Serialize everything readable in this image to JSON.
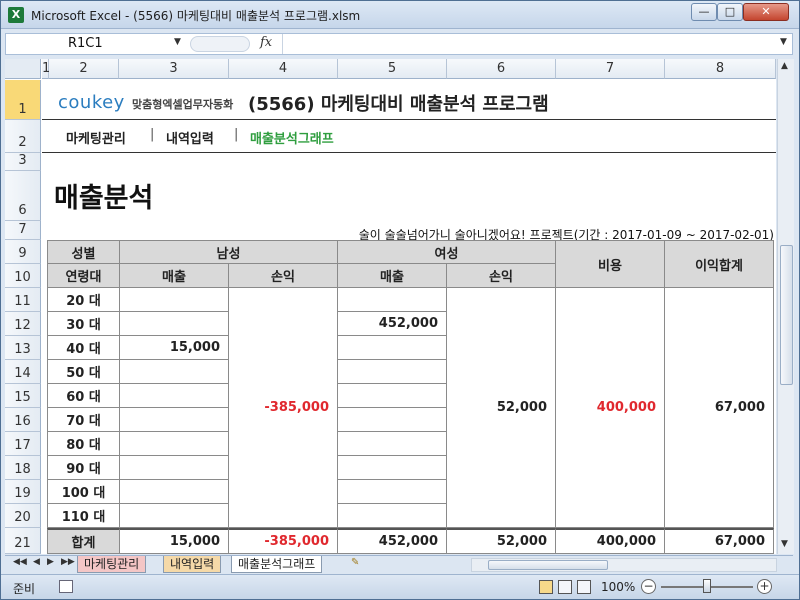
{
  "window": {
    "title": "Microsoft Excel - (5566) 마케팅대비 매출분석 프로그램.xlsm",
    "app_icon": "X"
  },
  "formula_bar": {
    "name_box": "R1C1",
    "fx": "fx",
    "value": ""
  },
  "columns": [
    "1",
    "2",
    "3",
    "4",
    "5",
    "6",
    "7",
    "8"
  ],
  "rows": [
    "1",
    "2",
    "3",
    "6",
    "7",
    "9",
    "10",
    "11",
    "12",
    "13",
    "14",
    "15",
    "16",
    "17",
    "18",
    "19",
    "20",
    "21"
  ],
  "sheet": {
    "brand": "coukey",
    "brand_sub": "맞춤형엑셀업무자동화",
    "doc_title": "(5566) 마케팅대비 매출분석 프로그램",
    "nav": [
      "마케팅관리",
      "내역입력",
      "매출분석그래프"
    ],
    "nav_sep": "|",
    "nav_active_color": "#2f9e3f",
    "heading": "매출분석",
    "period_note": "술이 술술넘어가니 술아니겠어요! 프로젝트(기간 : 2017-01-09 ~ 2017-02-01)"
  },
  "table": {
    "h_gender": "성별",
    "h_age": "연령대",
    "h_male": "남성",
    "h_female": "여성",
    "h_sales": "매출",
    "h_profit": "손익",
    "h_cost": "비용",
    "h_total_profit": "이익합계",
    "ages": [
      "20 대",
      "30 대",
      "40 대",
      "50 대",
      "60 대",
      "70 대",
      "80 대",
      "90 대",
      "100 대",
      "110 대"
    ],
    "male_sales": [
      "",
      "",
      "15,000",
      "",
      "",
      "",
      "",
      "",
      "",
      ""
    ],
    "female_sales": [
      "",
      "452,000",
      "",
      "",
      "",
      "",
      "",
      "",
      "",
      ""
    ],
    "male_profit_merged": "-385,000",
    "female_profit_merged": "52,000",
    "cost_merged": "400,000",
    "total_profit_merged": "67,000",
    "totals": {
      "label": "합계",
      "male_sales": "15,000",
      "male_profit": "-385,000",
      "female_sales": "452,000",
      "female_profit": "52,000",
      "cost": "400,000",
      "total_profit": "67,000"
    },
    "negative_color": "#e0282e"
  },
  "tabs": [
    "마케팅관리",
    "내역입력",
    "매출분석그래프"
  ],
  "active_tab": "매출분석그래프",
  "status": {
    "ready": "준비",
    "zoom": "100%"
  }
}
